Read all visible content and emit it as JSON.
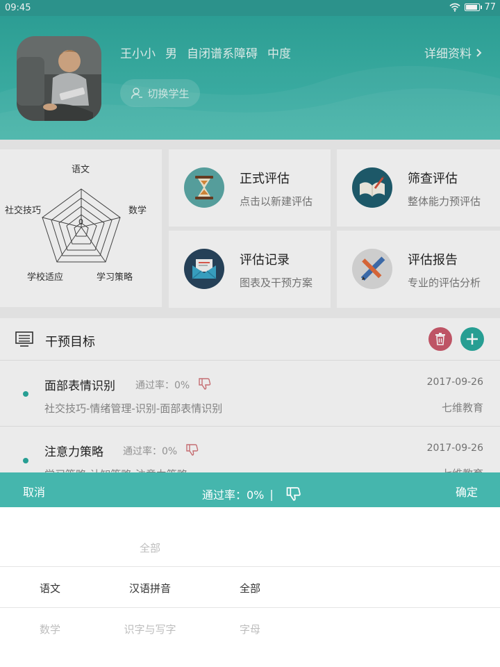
{
  "status_bar": {
    "time": "09:45",
    "battery": "77",
    "battery_level": 0.77
  },
  "profile": {
    "name": "王小小",
    "gender": "男",
    "condition": "自闭谱系障碍",
    "severity": "中度",
    "details_link": "详细资料",
    "switch_button": "切换学生"
  },
  "radar": {
    "labels": {
      "top": "语文",
      "right": "数学",
      "bottom_right": "学习策略",
      "bottom_left": "学校适应",
      "left": "社交技巧"
    },
    "center_value": "0"
  },
  "cards": [
    {
      "title": "正式评估",
      "subtitle": "点击以新建评估",
      "icon": "hourglass-icon"
    },
    {
      "title": "筛查评估",
      "subtitle": "整体能力预评估",
      "icon": "book-pen-icon"
    },
    {
      "title": "评估记录",
      "subtitle": "图表及干预方案",
      "icon": "envelope-icon"
    },
    {
      "title": "评估报告",
      "subtitle": "专业的评估分析",
      "icon": "ruler-pencil-icon"
    }
  ],
  "goals": {
    "title": "干预目标",
    "items": [
      {
        "name": "面部表情识别",
        "rate": "通过率：0%",
        "date": "2017-09-26",
        "path": "社交技巧-情绪管理-识别-面部表情识别",
        "org": "七维教育"
      },
      {
        "name": "注意力策略",
        "rate": "通过率：0%",
        "date": "2017-09-26",
        "path": "学习策略-认知策略-注意力策略",
        "org": "七维教育"
      }
    ]
  },
  "picker_bar": {
    "cancel": "取消",
    "center": "通过率：0%",
    "separator": "|",
    "confirm": "确定"
  },
  "picker": {
    "rows": [
      {
        "col2": "全部"
      },
      {
        "col1": "语文",
        "col2": "汉语拼音",
        "col3": "全部"
      },
      {
        "col1": "数学",
        "col2": "识字与写字",
        "col3": "字母"
      }
    ]
  },
  "colors": {
    "primary": "#45b6ad",
    "header": "#2fa69c",
    "delete": "#c9596b",
    "add": "#2aa79b"
  }
}
